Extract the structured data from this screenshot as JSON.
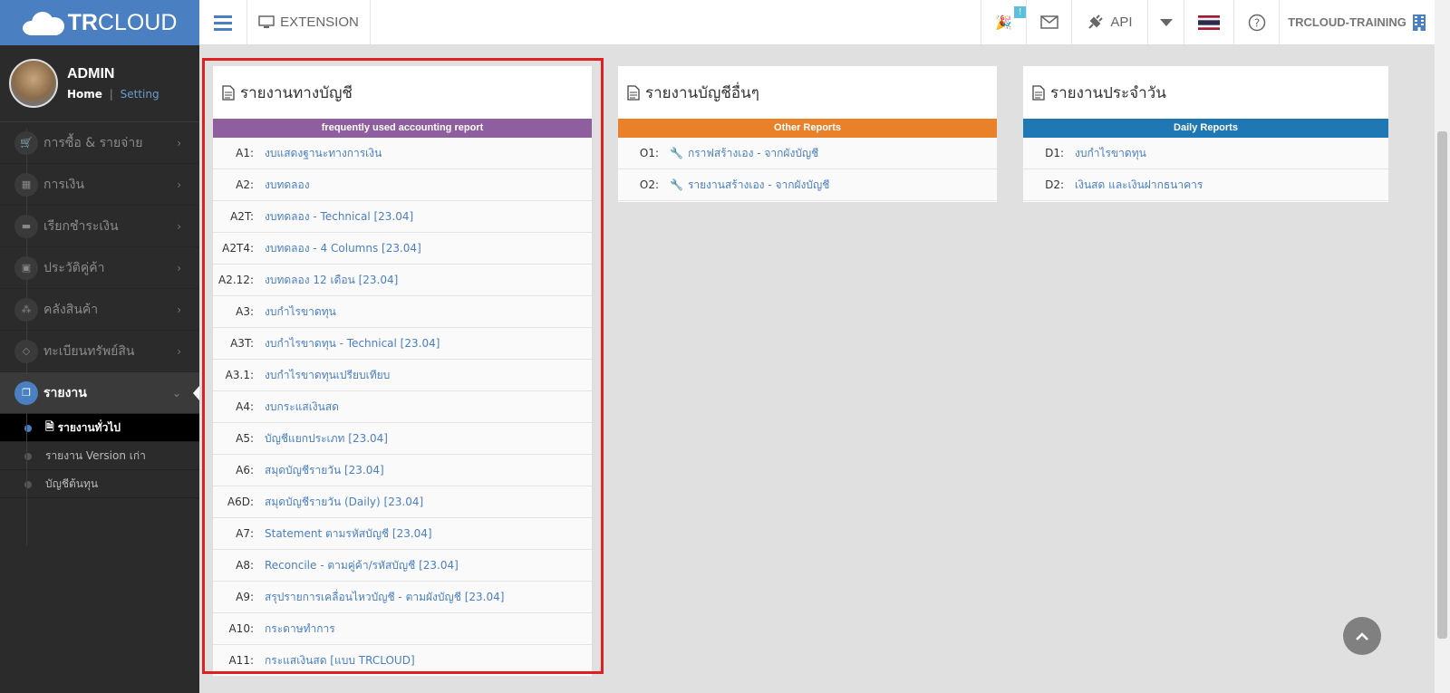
{
  "brand": {
    "bold": "TR",
    "rest": "CLOUD"
  },
  "topbar": {
    "extension_label": "EXTENSION",
    "notification_badge": "!",
    "api_label": "API",
    "company": "TRCLOUD-TRAINING"
  },
  "profile": {
    "name": "ADMIN",
    "home": "Home",
    "sep": "|",
    "setting": "Setting"
  },
  "sidebar": {
    "items": [
      {
        "label": "การซื้อ & รายจ่าย",
        "icon": "cart-icon",
        "glyph": "🛒"
      },
      {
        "label": "การเงิน",
        "icon": "calendar-icon",
        "glyph": "▦"
      },
      {
        "label": "เรียกชำระเงิน",
        "icon": "credit-card-icon",
        "glyph": "▬"
      },
      {
        "label": "ประวัติคู่ค้า",
        "icon": "contact-card-icon",
        "glyph": "▣"
      },
      {
        "label": "คลังสินค้า",
        "icon": "cubes-icon",
        "glyph": "⁂"
      },
      {
        "label": "ทะเบียนทรัพย์สิน",
        "icon": "diamond-icon",
        "glyph": "◇"
      },
      {
        "label": "รายงาน",
        "icon": "copy-icon",
        "glyph": "❐"
      }
    ],
    "sub_items": [
      {
        "label": "รายงานทั่วไป"
      },
      {
        "label": "รายงาน Version เก่า"
      },
      {
        "label": "บัญชีต้นทุน"
      }
    ]
  },
  "panels": [
    {
      "title": "รายงานทางบัญชี",
      "bar_label": "frequently used accounting report",
      "bar_color": "#8e5e9e",
      "rows": [
        {
          "code": "A1:",
          "label": "งบแสดงฐานะทางการเงิน"
        },
        {
          "code": "A2:",
          "label": "งบทดลอง"
        },
        {
          "code": "A2T:",
          "label": "งบทดลอง - Technical [23.04]"
        },
        {
          "code": "A2T4:",
          "label": "งบทดลอง - 4 Columns [23.04]"
        },
        {
          "code": "A2.12:",
          "label": "งบทดลอง 12 เดือน [23.04]"
        },
        {
          "code": "A3:",
          "label": "งบกำไรขาดทุน"
        },
        {
          "code": "A3T:",
          "label": "งบกำไรขาดทุน - Technical [23.04]"
        },
        {
          "code": "A3.1:",
          "label": "งบกำไรขาดทุนเปรียบเทียบ"
        },
        {
          "code": "A4:",
          "label": "งบกระแสเงินสด"
        },
        {
          "code": "A5:",
          "label": "บัญชีแยกประเภท [23.04]"
        },
        {
          "code": "A6:",
          "label": "สมุดบัญชีรายวัน [23.04]"
        },
        {
          "code": "A6D:",
          "label": "สมุดบัญชีรายวัน (Daily) [23.04]"
        },
        {
          "code": "A7:",
          "label": "Statement ตามรหัสบัญชี [23.04]"
        },
        {
          "code": "A8:",
          "label": "Reconcile - ตามคู่ค้า/รหัสบัญชี [23.04]"
        },
        {
          "code": "A9:",
          "label": "สรุปรายการเคลื่อนไหวบัญชี - ตามผังบัญชี [23.04]"
        },
        {
          "code": "A10:",
          "label": "กระดาษทำการ"
        },
        {
          "code": "A11:",
          "label": "กระแสเงินสด [แบบ TRCLOUD]"
        }
      ]
    },
    {
      "title": "รายงานบัญชีอื่นๆ",
      "bar_label": "Other Reports",
      "bar_color": "#e8812a",
      "rows": [
        {
          "code": "O1:",
          "label": "กราฟสร้างเอง - จากผังบัญชี"
        },
        {
          "code": "O2:",
          "label": "รายงานสร้างเอง - จากผังบัญชี"
        }
      ]
    },
    {
      "title": "รายงานประจำวัน",
      "bar_label": "Daily Reports",
      "bar_color": "#1f78b4",
      "rows": [
        {
          "code": "D1:",
          "label": "งบกำไรขาดทุน"
        },
        {
          "code": "D2:",
          "label": "เงินสด และเงินฝากธนาคาร"
        }
      ]
    }
  ]
}
